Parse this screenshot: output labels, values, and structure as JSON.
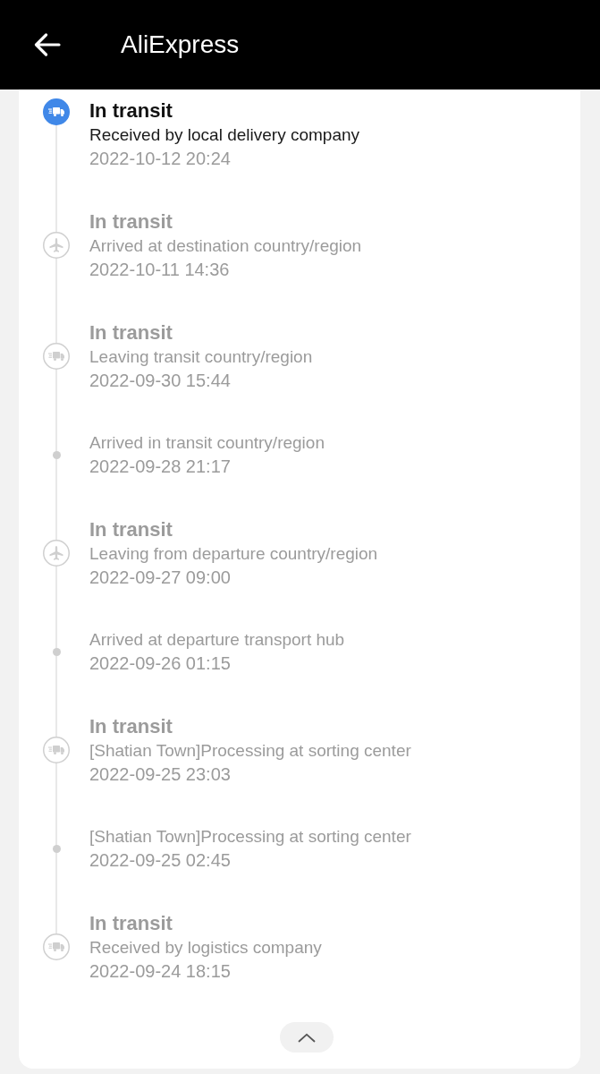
{
  "header": {
    "title": "AliExpress"
  },
  "events": [
    {
      "kind": "truck",
      "active": true,
      "status": "In transit",
      "description": "Received by local delivery company",
      "time": "2022-10-12 20:24"
    },
    {
      "kind": "plane",
      "active": false,
      "status": "In transit",
      "description": "Arrived at destination country/region",
      "time": "2022-10-11 14:36"
    },
    {
      "kind": "truck",
      "active": false,
      "status": "In transit",
      "description": "Leaving transit country/region",
      "time": "2022-09-30 15:44"
    },
    {
      "kind": "dot",
      "active": false,
      "description": "Arrived in transit country/region",
      "time": "2022-09-28 21:17"
    },
    {
      "kind": "plane",
      "active": false,
      "status": "In transit",
      "description": "Leaving from departure country/region",
      "time": "2022-09-27 09:00"
    },
    {
      "kind": "dot",
      "active": false,
      "description": "Arrived at departure transport hub",
      "time": "2022-09-26 01:15"
    },
    {
      "kind": "truck",
      "active": false,
      "status": "In transit",
      "description": "[Shatian Town]Processing at sorting center",
      "time": "2022-09-25 23:03"
    },
    {
      "kind": "dot",
      "active": false,
      "description": "[Shatian Town]Processing at sorting center",
      "time": "2022-09-25 02:45"
    },
    {
      "kind": "truck",
      "active": false,
      "status": "In transit",
      "description": "Received by logistics company",
      "time": "2022-09-24 18:15"
    }
  ],
  "collapse": {
    "expanded": true
  }
}
